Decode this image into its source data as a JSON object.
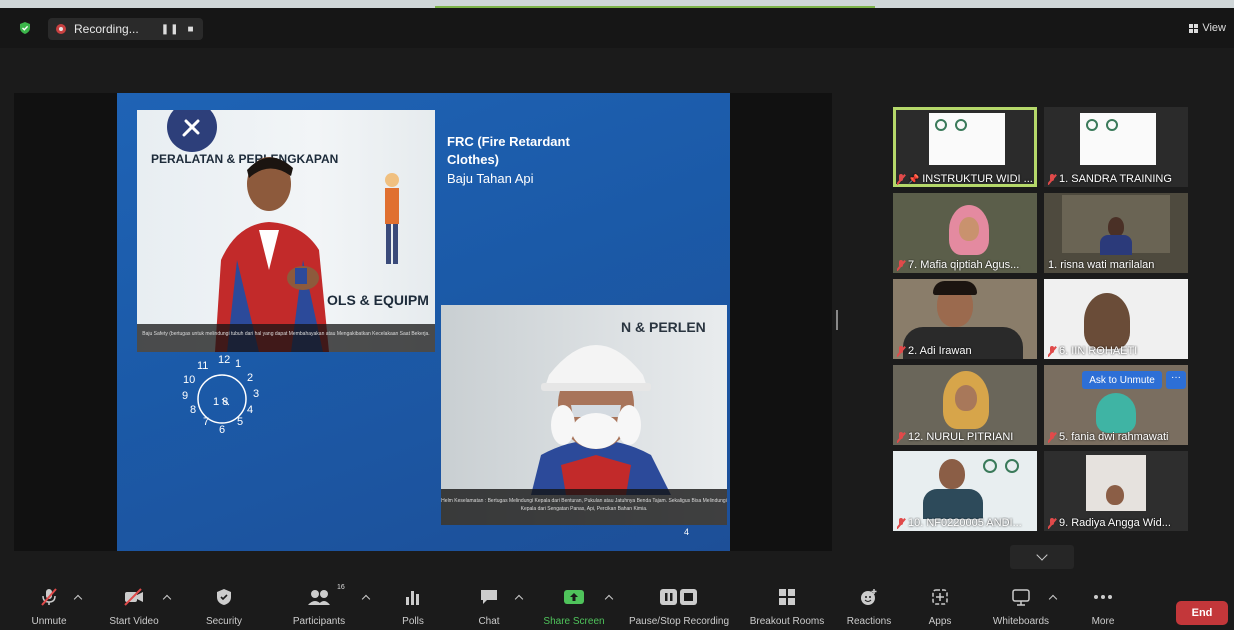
{
  "topbar": {
    "recording_label": "Recording...",
    "pause_glyph": "❚❚",
    "stop_glyph": "■",
    "view_label": "View"
  },
  "slide": {
    "title": "FRC (Fire Retardant Clothes)",
    "subtitle": "Baju Tahan Api",
    "photo1_poster_heading": "PERALATAN & PERLENGKAPAN",
    "photo1_poster_tools": "OLS & EQUIPM",
    "photo1_caption": "Baju Safety (bertugas untuk melindungi tubuh dari hal yang dapat Membahayakan atau Mengakibatkan Kecelakaan Saat Bekerja.",
    "photo2_wall_text": "N & PERLEN",
    "photo2_caption": "Helm Keselamatan : Bertugas Melindungi Kepala dari Benturan, Pukulan atau Jatuhnya Benda Tajam. Sekaligus Bisa Melindungi Kepala dari Sengatan Panas, Api, Percikan Bahan Kimia.",
    "page_number": "4",
    "clock_numbers": [
      "12",
      "1",
      "2",
      "3",
      "4",
      "5",
      "6",
      "7",
      "8",
      "9",
      "10",
      "11"
    ],
    "clock_inner": "1 8"
  },
  "participants": [
    {
      "name": "INSTRUKTUR WIDI ..."
    },
    {
      "name": "1. SANDRA TRAINING"
    },
    {
      "name": "7. Mafia qiptiah Agus..."
    },
    {
      "name": "1. risna wati marilalan"
    },
    {
      "name": "2. Adi Irawan"
    },
    {
      "name": "6. IIN ROHAETI"
    },
    {
      "name": "12. NURUL PITRIANI"
    },
    {
      "name": "5. fania dwi rahmawati"
    },
    {
      "name": "10. NF0220005 ANDI..."
    },
    {
      "name": "9. Radiya Angga Wid..."
    }
  ],
  "overlay": {
    "ask_to_unmute": "Ask to Unmute",
    "more": "···"
  },
  "toolbar": {
    "unmute": "Unmute",
    "start_video": "Start Video",
    "security": "Security",
    "participants": "Participants",
    "participants_count": "16",
    "polls": "Polls",
    "chat": "Chat",
    "share_screen": "Share Screen",
    "pause_stop_recording": "Pause/Stop Recording",
    "breakout_rooms": "Breakout Rooms",
    "reactions": "Reactions",
    "apps": "Apps",
    "whiteboards": "Whiteboards",
    "more": "More",
    "end": "End"
  },
  "colors": {
    "share_green": "#4fc35b",
    "end_red": "#c3373a",
    "active_speaker": "#b5d86a",
    "unmute_blue": "#2d6fd6",
    "slide_blue": "#1f63b5"
  }
}
